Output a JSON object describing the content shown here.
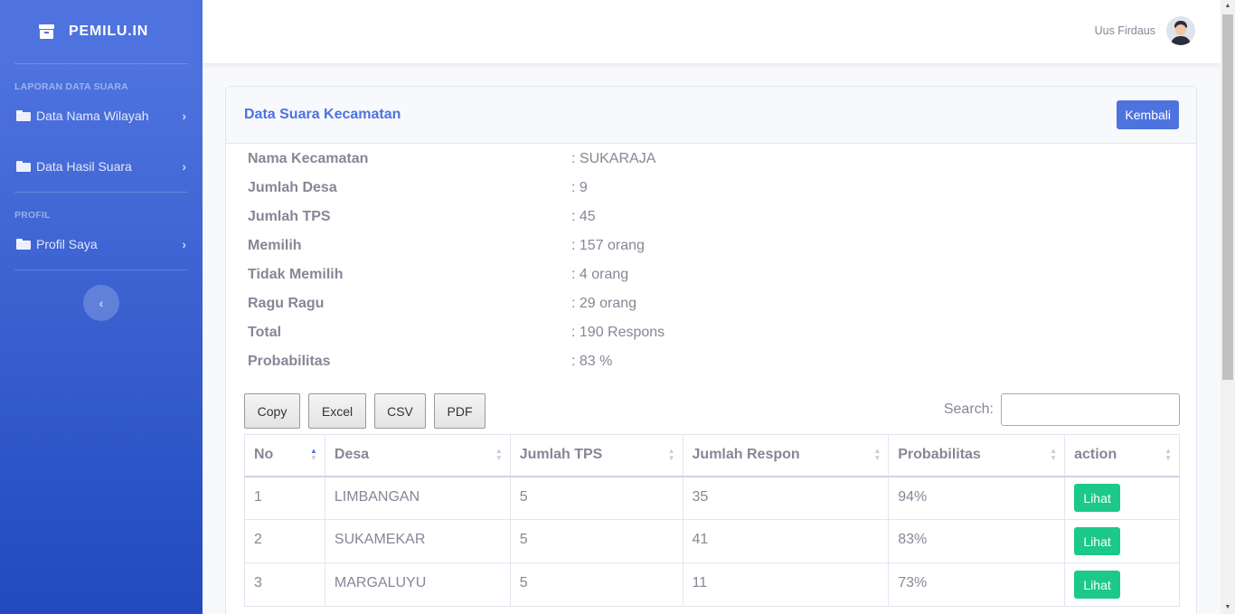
{
  "sidebar": {
    "brand": "PEMILU.IN",
    "sections": [
      {
        "heading": "LAPORAN DATA SUARA",
        "items": [
          "Data Nama Wilayah",
          "Data Hasil Suara"
        ]
      },
      {
        "heading": "PROFIL",
        "items": [
          "Profil Saya"
        ]
      }
    ]
  },
  "topbar": {
    "user_name": "Uus Firdaus"
  },
  "card": {
    "title": "Data Suara Kecamatan",
    "back_label": "Kembali",
    "info": [
      {
        "label": "Nama Kecamatan",
        "value": ": SUKARAJA"
      },
      {
        "label": "Jumlah Desa",
        "value": ": 9"
      },
      {
        "label": "Jumlah TPS",
        "value": ": 45"
      },
      {
        "label": "Memilih",
        "value": ": 157 orang"
      },
      {
        "label": "Tidak Memilih",
        "value": ": 4 orang"
      },
      {
        "label": "Ragu Ragu",
        "value": ": 29 orang"
      },
      {
        "label": "Total",
        "value": ": 190 Respons"
      },
      {
        "label": "Probabilitas",
        "value": ": 83 %"
      }
    ]
  },
  "table_tools": {
    "buttons": [
      "Copy",
      "Excel",
      "CSV",
      "PDF"
    ],
    "search_label": "Search:"
  },
  "table": {
    "columns": [
      "No",
      "Desa",
      "Jumlah TPS",
      "Jumlah Respon",
      "Probabilitas",
      "action"
    ],
    "rows": [
      {
        "no": "1",
        "desa": "LIMBANGAN",
        "tps": "5",
        "respon": "35",
        "prob": "94%",
        "action": "Lihat"
      },
      {
        "no": "2",
        "desa": "SUKAMEKAR",
        "tps": "5",
        "respon": "41",
        "prob": "83%",
        "action": "Lihat"
      },
      {
        "no": "3",
        "desa": "MARGALUYU",
        "tps": "5",
        "respon": "11",
        "prob": "73%",
        "action": "Lihat"
      }
    ]
  }
}
